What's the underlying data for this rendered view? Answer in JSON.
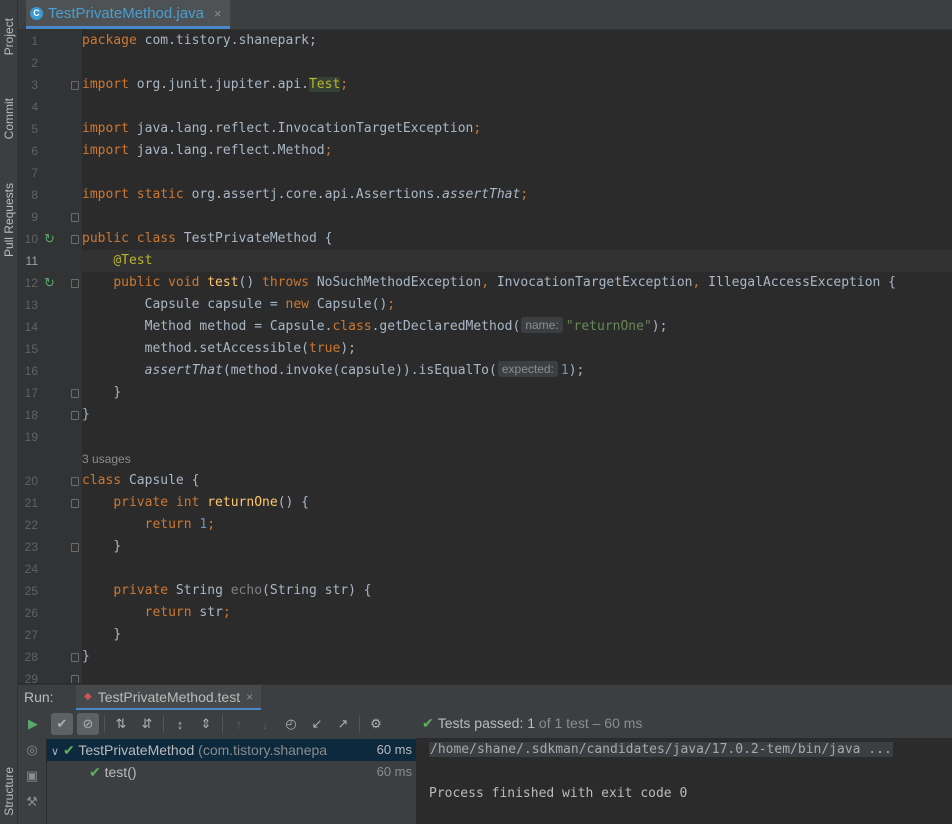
{
  "editor": {
    "tab": {
      "filename": "TestPrivateMethod.java",
      "icon": "java-class-icon",
      "close": "×"
    },
    "current_line": 11,
    "lines": [
      {
        "n": "1"
      },
      {
        "n": "2"
      },
      {
        "n": "3"
      },
      {
        "n": "4"
      },
      {
        "n": "5"
      },
      {
        "n": "6"
      },
      {
        "n": "7"
      },
      {
        "n": "8"
      },
      {
        "n": "9"
      },
      {
        "n": "10"
      },
      {
        "n": "11"
      },
      {
        "n": "12"
      },
      {
        "n": "13"
      },
      {
        "n": "14"
      },
      {
        "n": "15"
      },
      {
        "n": "16"
      },
      {
        "n": "17"
      },
      {
        "n": "18"
      },
      {
        "n": "19"
      },
      {
        "n": "20"
      },
      {
        "n": "21"
      },
      {
        "n": "22"
      },
      {
        "n": "23"
      },
      {
        "n": "24"
      },
      {
        "n": "25"
      },
      {
        "n": "26"
      },
      {
        "n": "27"
      },
      {
        "n": "28"
      },
      {
        "n": "29"
      }
    ],
    "code": {
      "l1_kw": "package",
      "l1_rest": " com.tistory.shanepark;",
      "l3_kw": "import",
      "l3_pkg": " org.junit.jupiter.api.",
      "l3_cls": "Test",
      "l3_end": ";",
      "l5_kw": "import",
      "l5_rest": " java.lang.reflect.InvocationTargetException",
      "l5_end": ";",
      "l6_kw": "import",
      "l6_rest": " java.lang.reflect.Method",
      "l6_end": ";",
      "l8_kw": "import static",
      "l8_rest": " org.assertj.core.api.Assertions.",
      "l8_it": "assertThat",
      "l8_end": ";",
      "l10_kw": "public class",
      "l10_rest": " TestPrivateMethod {",
      "l11_ann": "@Test",
      "l12_kw1": "public void",
      "l12_fn": "test",
      "l12_p": "() ",
      "l12_kw2": "throws",
      "l12_e1": " NoSuchMethodException",
      "l12_c1": ",",
      "l12_e2": " InvocationTargetException",
      "l12_c2": ",",
      "l12_e3": " IllegalAccessException {",
      "l13_a": "Capsule capsule = ",
      "l13_kw": "new",
      "l13_b": " Capsule()",
      "l13_end": ";",
      "l14_a": "Method method = Capsule.",
      "l14_kw": "class",
      "l14_b": ".getDeclaredMethod(",
      "l14_hint": "name:",
      "l14_str": "\"returnOne\"",
      "l14_end": ");",
      "l15_a": "method.setAccessible(",
      "l15_kw": "true",
      "l15_end": ");",
      "l16_it": "assertThat",
      "l16_a": "(method.invoke(capsule)).isEqualTo(",
      "l16_hint": "expected:",
      "l16_num": "1",
      "l16_end": ");",
      "l17": "}",
      "l18": "}",
      "usages": "3 usages",
      "l20_kw": "class",
      "l20_rest": " Capsule {",
      "l21_kw": "private int",
      "l21_fn": "returnOne",
      "l21_rest": "() {",
      "l22_kw": "return",
      "l22_num": "1",
      "l22_end": ";",
      "l23": "}",
      "l25_kw": "private",
      "l25_a": " String ",
      "l25_fn": "echo",
      "l25_b": "(String str) {",
      "l26_kw": "return",
      "l26_a": " str",
      "l26_end": ";",
      "l27": "}",
      "l28": "}"
    }
  },
  "sidebar": {
    "project": "Project",
    "commit": "Commit",
    "pull_requests": "Pull Requests",
    "structure": "Structure"
  },
  "run": {
    "label": "Run:",
    "tab_name": "TestPrivateMethod.test",
    "tab_close": "×",
    "status": {
      "prefix": "Tests passed: ",
      "count": "1",
      "rest": " of 1 test – 60 ms"
    },
    "tree": [
      {
        "name": "TestPrivateMethod",
        "pkg": " (com.tistory.shanepa",
        "time": "60 ms"
      },
      {
        "name": "test()",
        "time": "60 ms"
      }
    ],
    "console": {
      "command": "/home/shane/.sdkman/candidates/java/17.0.2-tem/bin/java ...",
      "exit": "Process finished with exit code 0"
    }
  },
  "colors": {
    "keyword": "#cc7832",
    "annotation": "#bbb529",
    "number": "#6897bb",
    "string": "#6a8759",
    "function": "#ffc66d",
    "pass": "#5fb05f",
    "accent": "#4a88c7"
  }
}
